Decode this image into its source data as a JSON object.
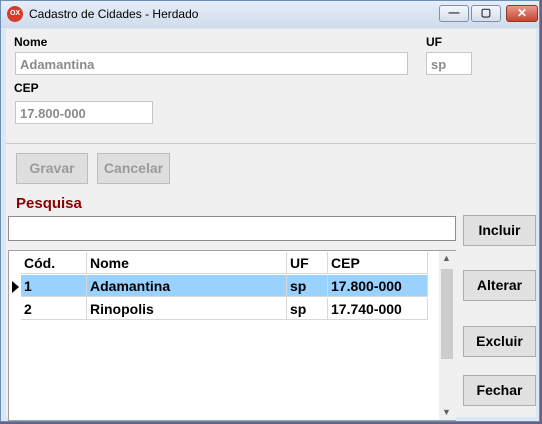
{
  "window": {
    "title": "Cadastro de Cidades - Herdado",
    "app_icon_text": "OX",
    "controls": {
      "minimize": "—",
      "maximize": "▢",
      "close": "✕"
    }
  },
  "form": {
    "nome_label": "Nome",
    "nome_value": "Adamantina",
    "uf_label": "UF",
    "uf_value": "sp",
    "cep_label": "CEP",
    "cep_value": "17.800-000"
  },
  "actions": {
    "gravar": "Gravar",
    "cancelar": "Cancelar",
    "incluir": "Incluir",
    "alterar": "Alterar",
    "excluir": "Excluir",
    "fechar": "Fechar"
  },
  "search": {
    "title": "Pesquisa",
    "value": ""
  },
  "grid": {
    "headers": [
      "Cód.",
      "Nome",
      "UF",
      "CEP"
    ],
    "rows": [
      [
        "1",
        "Adamantina",
        "sp",
        "17.800-000"
      ],
      [
        "2",
        "Rinopolis",
        "sp",
        "17.740-000"
      ]
    ],
    "selected_row": 0
  },
  "colors": {
    "selection": "#99d1ff",
    "pesquisa_title": "#8b0000"
  }
}
